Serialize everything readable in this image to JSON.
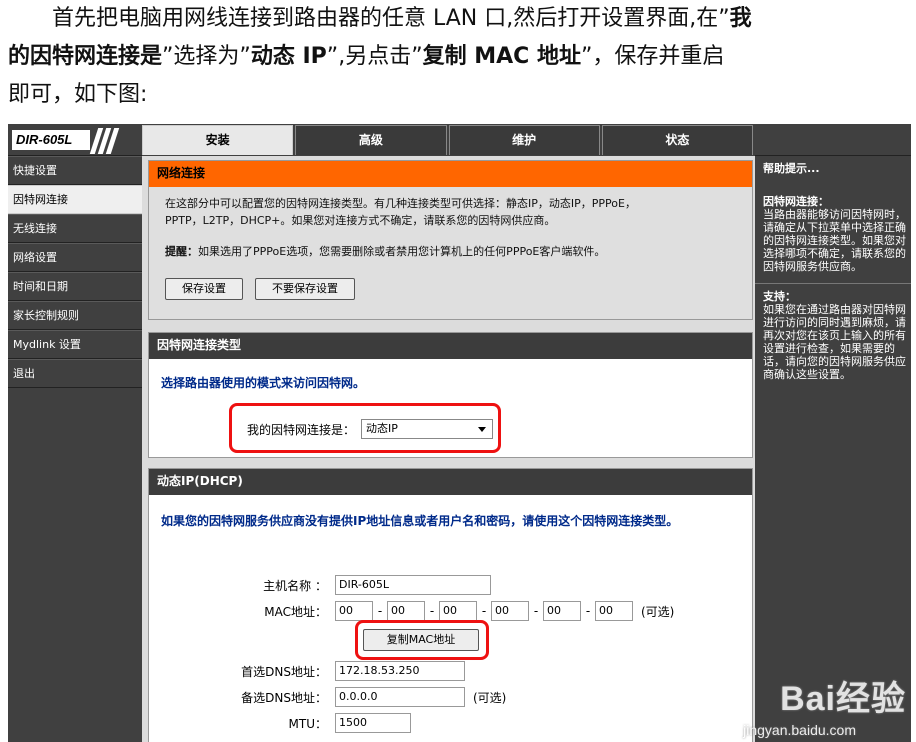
{
  "article": {
    "line1_text": "首先把电脑用网线连接到路由器的任意 LAN 口,然后打开设置界面,在”",
    "line1_bold": "我",
    "line2_bold1": "的因特网连接是",
    "line2_text1": "”选择为”",
    "line2_bold2": "动态 IP",
    "line2_text2": "”,另点击”",
    "line2_bold3": "复制 MAC 地址",
    "line2_text3": "”，保存并重启",
    "line3_text": "即可，如下图:"
  },
  "router": {
    "logo": "DIR-605L",
    "tabs": [
      "安装",
      "高级",
      "维护",
      "状态"
    ],
    "sidebar": [
      "快捷设置",
      "因特网连接",
      "无线连接",
      "网络设置",
      "时间和日期",
      "家长控制规则",
      "Mydlink 设置",
      "退出"
    ],
    "network_panel": {
      "title": "网络连接",
      "desc_line1": "在这部分中可以配置您的因特网连接类型。有几种连接类型可供选择：静态IP，动态IP，PPPoE，",
      "desc_line2": "PPTP，L2TP，DHCP+。如果您对连接方式不确定，请联系您的因特网供应商。",
      "warn_label": "提醒：",
      "warn_text": "如果选用了PPPoE选项，您需要删除或者禁用您计算机上的任何PPPoE客户端软件。",
      "save_btn": "保存设置",
      "nosave_btn": "不要保存设置"
    },
    "type_panel": {
      "title": "因特网连接类型",
      "prompt": "选择路由器使用的模式来访问因特网。",
      "conn_label": "我的因特网连接是：",
      "conn_value": "动态IP"
    },
    "dhcp_panel": {
      "title": "动态IP(DHCP)",
      "prompt": "如果您的因特网服务供应商没有提供IP地址信息或者用户名和密码，请使用这个因特网连接类型。",
      "host_label": "主机名称 ：",
      "host_value": "DIR-605L",
      "mac_label": "MAC地址：",
      "mac": [
        "00",
        "00",
        "00",
        "00",
        "00",
        "00"
      ],
      "optional": "(可选)",
      "copy_btn": "复制MAC地址",
      "dns1_label": "首选DNS地址：",
      "dns1_value": "172.18.53.250",
      "dns2_label": "备选DNS地址：",
      "dns2_value": "0.0.0.0",
      "mtu_label": "MTU：",
      "mtu_value": "1500"
    },
    "help": {
      "title": "帮助提示...",
      "sec1_title": "因特网连接：",
      "sec1_text": "当路由器能够访问因特网时，请确定从下拉菜单中选择正确的因特网连接类型。如果您对选择哪项不确定，请联系您的因特网服务供应商。",
      "sec2_title": "支持：",
      "sec2_text": "如果您在通过路由器对因特网进行访问的同时遇到麻烦，请再次对您在该页上输入的所有设置进行检查，如果需要的话，请向您的因特网服务供应商确认这些设置。"
    }
  },
  "watermark": {
    "brand": "Bai经验",
    "url": "jingyan.baidu.com"
  },
  "colors": {
    "accent_orange": "#ff6600",
    "highlight_red": "#e11111",
    "nav_dark": "#404040"
  }
}
